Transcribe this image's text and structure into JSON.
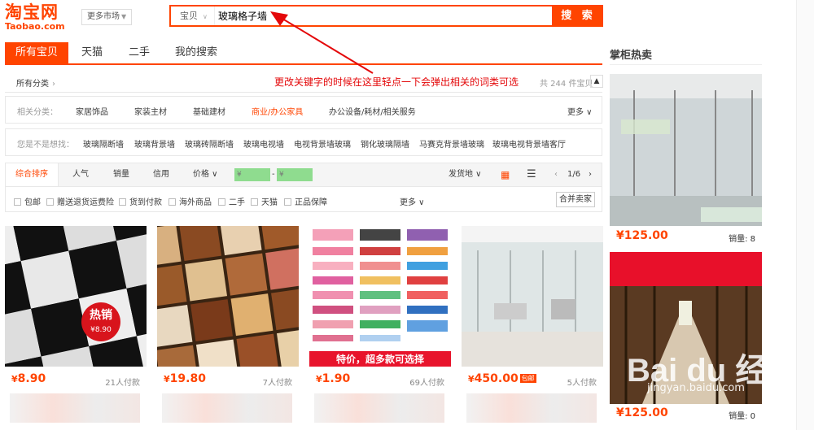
{
  "header": {
    "logo_cn": "淘宝网",
    "logo_en": "Taobao.com",
    "market_label": "更多市场",
    "search_type": "宝贝",
    "search_value": "玻璃格子墙",
    "search_button": "搜 索"
  },
  "tabs": [
    {
      "label": "所有宝贝",
      "active": true
    },
    {
      "label": "天猫",
      "active": false
    },
    {
      "label": "二手",
      "active": false
    },
    {
      "label": "我的搜索",
      "active": false
    }
  ],
  "hot_title": "掌柜热卖",
  "category_row": {
    "all_label": "所有分类",
    "annotation": "更改关键字的时候在这里轻点一下会弹出相关的词类可选",
    "result_count": "共 244 件宝贝"
  },
  "related": {
    "label": "相关分类：",
    "items": [
      "家居饰品",
      "家装主材",
      "基础建材",
      "商业/办公家具",
      "办公设备/耗材/相关服务"
    ],
    "highlight_index": 3,
    "more": "更多"
  },
  "suggest": {
    "label": "您是不是想找：",
    "items": [
      "玻璃隔断墙",
      "玻璃背景墙",
      "玻璃砖隔断墙",
      "玻璃电视墙",
      "电视背景墙玻璃",
      "钢化玻璃隔墙",
      "马赛克背景墙玻璃",
      "玻璃电视背景墙客厅"
    ]
  },
  "sortbar": {
    "items": [
      "综合排序",
      "人气",
      "销量",
      "信用",
      "价格"
    ],
    "price_from": "¥",
    "price_to": "¥",
    "ship_from": "发货地",
    "page": "1/6"
  },
  "options": {
    "items": [
      "包邮",
      "赠送退货运费险",
      "货到付款",
      "海外商品",
      "二手",
      "天猫",
      "正品保障"
    ],
    "more": "更多",
    "merge": "合并卖家"
  },
  "products": [
    {
      "price": "8.90",
      "sold": "21人付款",
      "badge": "热销",
      "badge_sub": "¥8.90"
    },
    {
      "price": "19.80",
      "sold": "7人付款"
    },
    {
      "price": "1.90",
      "sold": "69人付款",
      "banner": "特价，超多款可选择"
    },
    {
      "price": "450.00",
      "sold": "5人付款",
      "tag": "包邮"
    }
  ],
  "hot_items": [
    {
      "price": "125.00",
      "sold": "销量: 8"
    },
    {
      "price": "125.00",
      "sold": "销量: 0"
    }
  ],
  "watermark": {
    "text": "Bai du 经验",
    "url": "jingyan.baidu.com"
  },
  "colors": {
    "accent": "#ff4400",
    "annotation": "#e4080a"
  }
}
